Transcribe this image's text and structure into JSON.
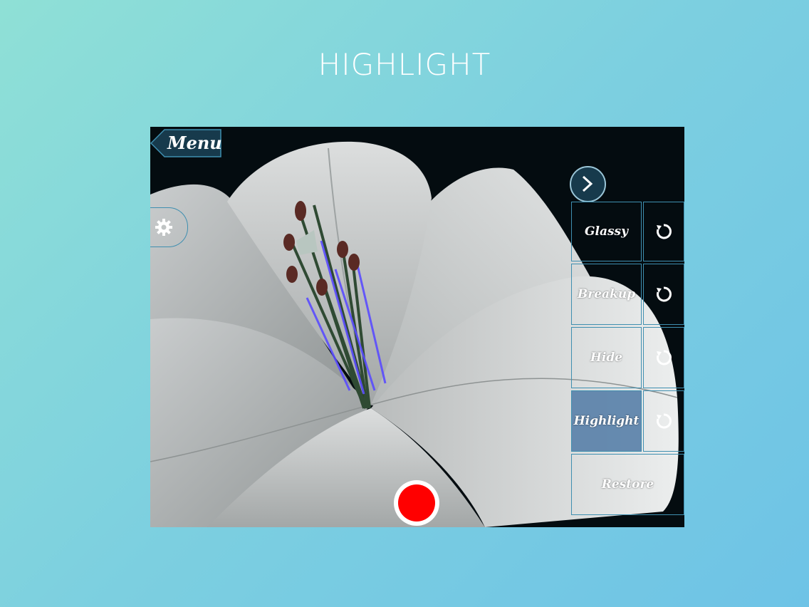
{
  "page": {
    "title": "HIGHLIGHT"
  },
  "app": {
    "menu_label": "Menu",
    "panel": {
      "buttons": [
        {
          "label": "Glassy",
          "active": false
        },
        {
          "label": "Breakup",
          "active": false
        },
        {
          "label": "Hide",
          "active": false
        },
        {
          "label": "Highlight",
          "active": true
        },
        {
          "label": "Restore",
          "active": false
        }
      ]
    }
  },
  "icons": {
    "menu": "back-arrow-tab",
    "settings": "gear-icon",
    "next": "chevron-right-icon",
    "reset": "rotate-ccw-icon",
    "record": "record-icon"
  },
  "colors": {
    "accent": "#3f8fb0",
    "active": "#5880a8",
    "record": "#ff0000",
    "highlight_outline": "#5a4cff"
  }
}
